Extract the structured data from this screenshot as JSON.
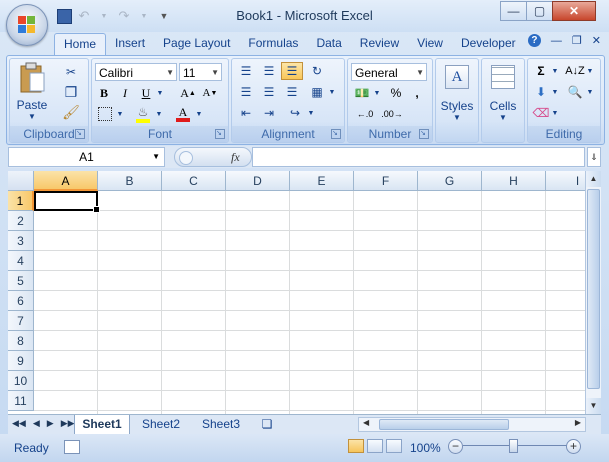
{
  "title": "Book1 - Microsoft Excel",
  "tabs": [
    "Home",
    "Insert",
    "Page Layout",
    "Formulas",
    "Data",
    "Review",
    "View",
    "Developer"
  ],
  "ribbon": {
    "clipboard": {
      "label": "Clipboard",
      "paste": "Paste"
    },
    "font": {
      "label": "Font",
      "family": "Calibri",
      "size": "11"
    },
    "alignment": {
      "label": "Alignment"
    },
    "number": {
      "label": "Number",
      "format": "General",
      "percent": "%",
      "comma": ","
    },
    "styles": {
      "label": "Styles"
    },
    "cells": {
      "label": "Cells"
    },
    "editing": {
      "label": "Editing"
    }
  },
  "namebox": "A1",
  "fx": "fx",
  "columns": [
    "A",
    "B",
    "C",
    "D",
    "E",
    "F",
    "G",
    "H",
    "I"
  ],
  "rows": [
    "1",
    "2",
    "3",
    "4",
    "5",
    "6",
    "7",
    "8",
    "9",
    "10",
    "11"
  ],
  "sheets": [
    "Sheet1",
    "Sheet2",
    "Sheet3"
  ],
  "status": {
    "ready": "Ready",
    "zoom": "100%"
  },
  "icons": {
    "help": "?"
  }
}
